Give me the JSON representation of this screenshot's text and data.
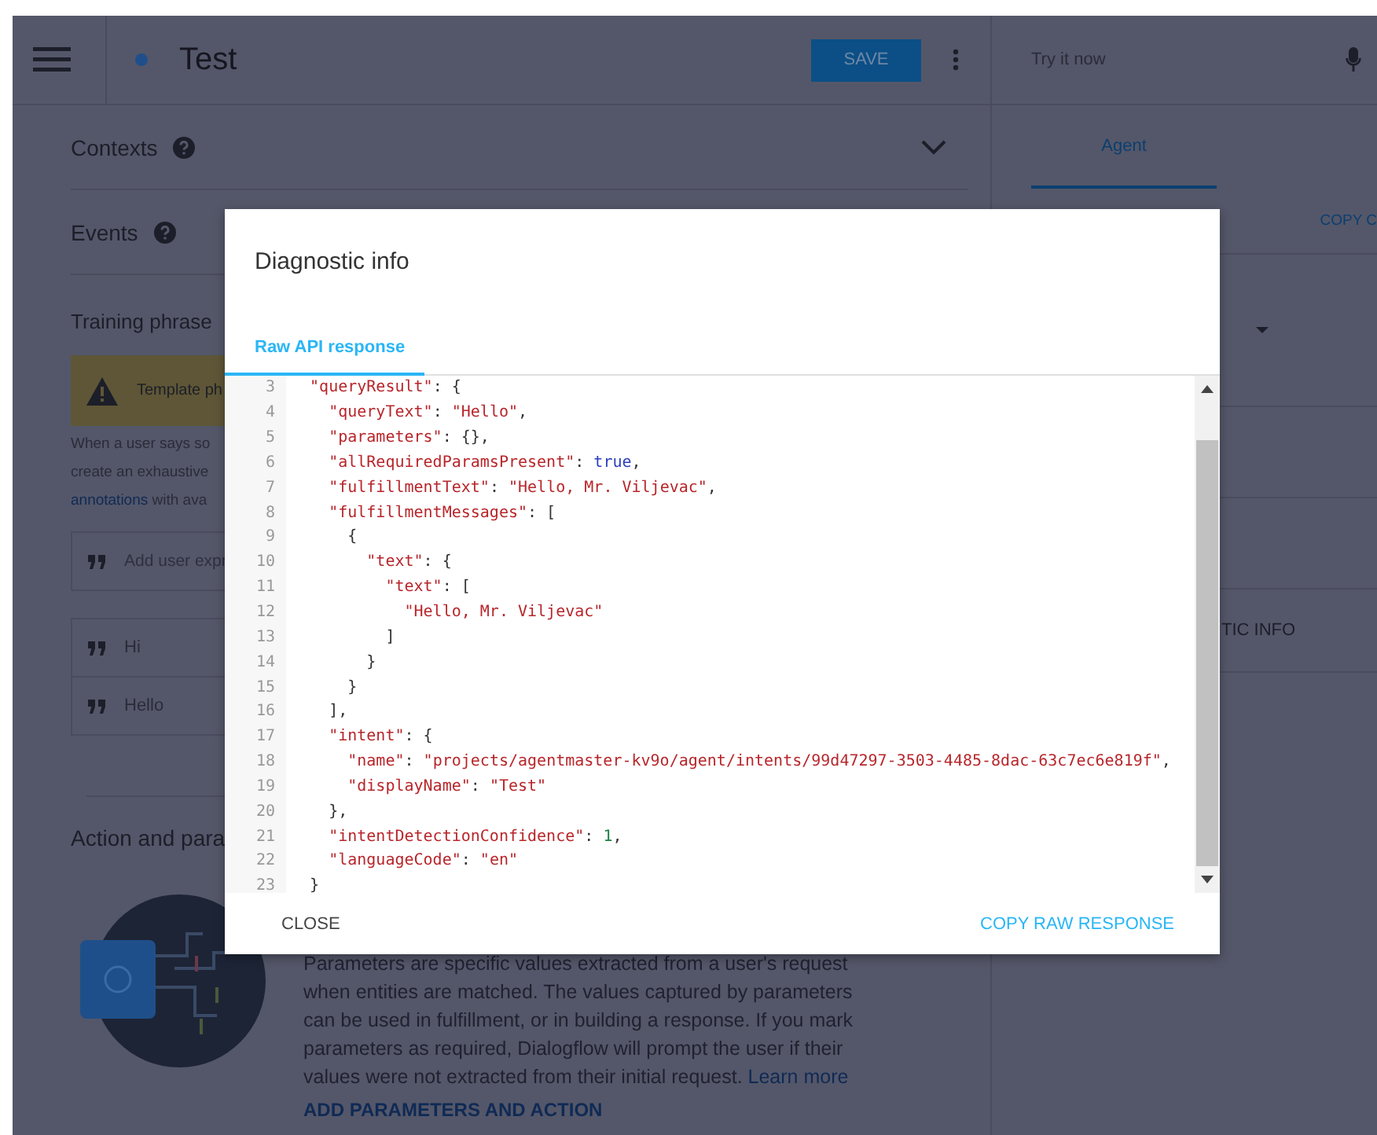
{
  "header": {
    "title": "Test",
    "save_button": "SAVE"
  },
  "sections": [
    {
      "title": "Contexts",
      "kind": "collapsible"
    },
    {
      "title": "Events",
      "kind": "plain"
    }
  ],
  "training": {
    "title": "Training phrase",
    "banner": "Template ph",
    "description_lines": [
      {
        "text": "When a user says so"
      },
      {
        "text": "create an exhaustive"
      },
      {
        "link": "annotations",
        "text": " with ava"
      }
    ],
    "input_placeholder": "Add user expr",
    "phrases": [
      "Hi",
      "Hello"
    ]
  },
  "action": {
    "title": "Action and para",
    "description": "Parameters are specific values extracted from a user's request when entities are matched. The values captured by parameters can be used in fulfillment, or in building a response. If you mark parameters as required, Dialogflow will prompt the user if their values were not extracted from their initial request.",
    "link": "Learn more",
    "button": "ADD PARAMETERS AND ACTION"
  },
  "right_panel": {
    "try_placeholder": "Try it now",
    "tabs": [
      {
        "label": "Agent",
        "selected": true
      }
    ],
    "copy_label": "COPY C",
    "diagnostic_label": "TIC INFO"
  },
  "dialog": {
    "title": "Diagnostic info",
    "tabs": [
      {
        "label": "Raw API response",
        "selected": true
      }
    ],
    "code_lines": [
      {
        "number": "3",
        "tokens": [
          {
            "kind": "key",
            "text": "  \"queryResult\""
          },
          {
            "kind": "punct",
            "text": ": {"
          }
        ]
      },
      {
        "number": "4",
        "tokens": [
          {
            "kind": "key",
            "text": "    \"queryText\""
          },
          {
            "kind": "punct",
            "text": ": "
          },
          {
            "kind": "string",
            "text": "\"Hello\""
          },
          {
            "kind": "punct",
            "text": ","
          }
        ]
      },
      {
        "number": "5",
        "tokens": [
          {
            "kind": "key",
            "text": "    \"parameters\""
          },
          {
            "kind": "punct",
            "text": ": {},"
          }
        ]
      },
      {
        "number": "6",
        "tokens": [
          {
            "kind": "key",
            "text": "    \"allRequiredParamsPresent\""
          },
          {
            "kind": "punct",
            "text": ": "
          },
          {
            "kind": "bool",
            "text": "true"
          },
          {
            "kind": "punct",
            "text": ","
          }
        ]
      },
      {
        "number": "7",
        "tokens": [
          {
            "kind": "key",
            "text": "    \"fulfillmentText\""
          },
          {
            "kind": "punct",
            "text": ": "
          },
          {
            "kind": "string",
            "text": "\"Hello, Mr. Viljevac\""
          },
          {
            "kind": "punct",
            "text": ","
          }
        ]
      },
      {
        "number": "8",
        "tokens": [
          {
            "kind": "key",
            "text": "    \"fulfillmentMessages\""
          },
          {
            "kind": "punct",
            "text": ": ["
          }
        ]
      },
      {
        "number": "9",
        "tokens": [
          {
            "kind": "punct",
            "text": "      {"
          }
        ]
      },
      {
        "number": "10",
        "tokens": [
          {
            "kind": "key",
            "text": "        \"text\""
          },
          {
            "kind": "punct",
            "text": ": {"
          }
        ]
      },
      {
        "number": "11",
        "tokens": [
          {
            "kind": "key",
            "text": "          \"text\""
          },
          {
            "kind": "punct",
            "text": ": ["
          }
        ]
      },
      {
        "number": "12",
        "tokens": [
          {
            "kind": "string",
            "text": "            \"Hello, Mr. Viljevac\""
          }
        ]
      },
      {
        "number": "13",
        "tokens": [
          {
            "kind": "punct",
            "text": "          ]"
          }
        ]
      },
      {
        "number": "14",
        "tokens": [
          {
            "kind": "punct",
            "text": "        }"
          }
        ]
      },
      {
        "number": "15",
        "tokens": [
          {
            "kind": "punct",
            "text": "      }"
          }
        ]
      },
      {
        "number": "16",
        "tokens": [
          {
            "kind": "punct",
            "text": "    ],"
          }
        ]
      },
      {
        "number": "17",
        "tokens": [
          {
            "kind": "key",
            "text": "    \"intent\""
          },
          {
            "kind": "punct",
            "text": ": {"
          }
        ]
      },
      {
        "number": "18",
        "tokens": [
          {
            "kind": "key",
            "text": "      \"name\""
          },
          {
            "kind": "punct",
            "text": ": "
          },
          {
            "kind": "string",
            "text": "\"projects/agentmaster-kv9o/agent/intents/99d47297-3503-4485-8dac-63c7ec6e819f\""
          },
          {
            "kind": "punct",
            "text": ","
          }
        ]
      },
      {
        "number": "19",
        "tokens": [
          {
            "kind": "key",
            "text": "      \"displayName\""
          },
          {
            "kind": "punct",
            "text": ": "
          },
          {
            "kind": "string",
            "text": "\"Test\""
          }
        ]
      },
      {
        "number": "20",
        "tokens": [
          {
            "kind": "punct",
            "text": "    },"
          }
        ]
      },
      {
        "number": "21",
        "tokens": [
          {
            "kind": "key",
            "text": "    \"intentDetectionConfidence\""
          },
          {
            "kind": "punct",
            "text": ": "
          },
          {
            "kind": "number",
            "text": "1"
          },
          {
            "kind": "punct",
            "text": ","
          }
        ]
      },
      {
        "number": "22",
        "tokens": [
          {
            "kind": "key",
            "text": "    \"languageCode\""
          },
          {
            "kind": "punct",
            "text": ": "
          },
          {
            "kind": "string",
            "text": "\"en\""
          }
        ]
      },
      {
        "number": "23",
        "tokens": [
          {
            "kind": "punct",
            "text": "  }"
          }
        ]
      }
    ],
    "buttons": [
      {
        "label": "CLOSE",
        "kind": "neutral"
      },
      {
        "label": "COPY RAW RESPONSE",
        "kind": "primary"
      }
    ]
  }
}
